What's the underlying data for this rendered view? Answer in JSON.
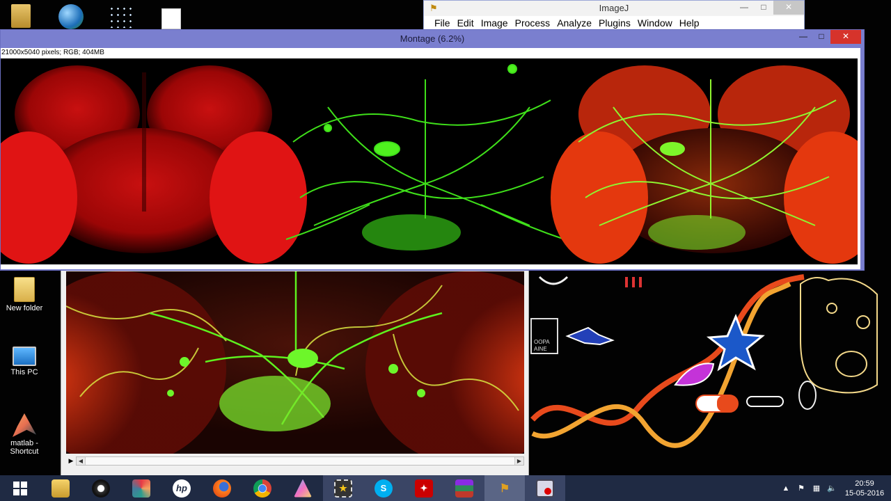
{
  "imagej_window": {
    "title": "ImageJ",
    "menu": [
      "File",
      "Edit",
      "Image",
      "Process",
      "Analyze",
      "Plugins",
      "Window",
      "Help"
    ]
  },
  "montage_window": {
    "title": "Montage (6.2%)",
    "info": "21000x5040 pixels; RGB; 404MB"
  },
  "desktop_icons": [
    {
      "label": "New folder",
      "icon": "folder-icon"
    },
    {
      "label": "This PC",
      "icon": "computer-icon"
    },
    {
      "label": "matlab - Shortcut",
      "icon": "matlab-icon"
    }
  ],
  "doodle_text": "OOPA\nAINE",
  "taskbar": {
    "apps": [
      "start-icon",
      "file-explorer-icon",
      "media-icon",
      "photo-app-icon",
      "hp-icon",
      "firefox-icon",
      "chrome-icon",
      "prism-icon",
      "movie-maker-icon",
      "skype-icon",
      "acrobat-icon",
      "winrar-icon",
      "imagej-icon",
      "recorder-icon"
    ],
    "hp_label": "hp",
    "skype_label": "S",
    "clock_time": "20:59",
    "clock_date": "15-05-2016"
  },
  "colors": {
    "taskbar": "#1f2a43",
    "montage_titlebar": "#7a7fcf",
    "close_red": "#d6332b"
  }
}
